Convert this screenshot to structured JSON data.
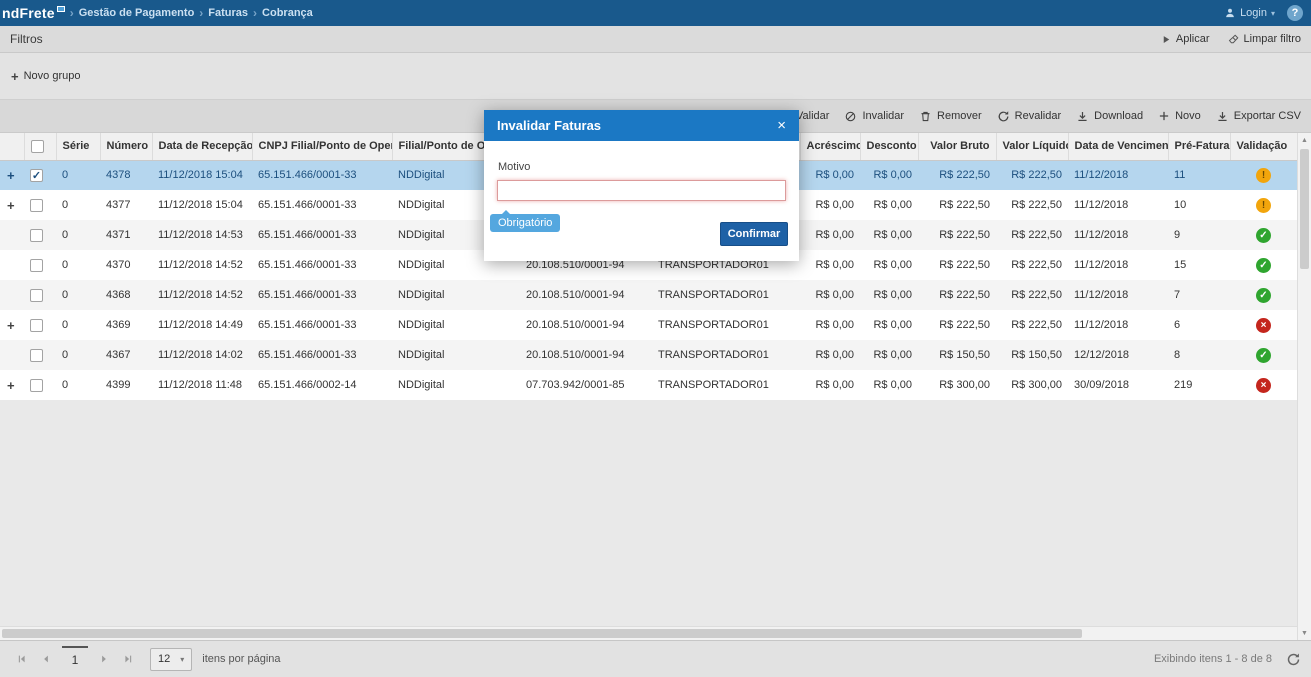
{
  "colors": {
    "topbar_bg": "#19598C",
    "modal_header_bg": "#1B78C4",
    "confirm_button_bg": "#1E61A6",
    "selected_row_bg": "#B5D6EE",
    "status_warning": "#F2A50C",
    "status_valid": "#2FA52F",
    "status_invalid": "#C4261D",
    "required_badge_bg": "#54A7DF"
  },
  "icons": {
    "plus": "+",
    "check": "✓",
    "cross": "×",
    "warning": "!",
    "sort_desc": "↓",
    "caret_down": "▾",
    "breadcrumb_sep": "›",
    "arrow_up": "▲",
    "arrow_down": "▼"
  },
  "topbar": {
    "logo": "ndFrete",
    "breadcrumbs": [
      "Gestão de Pagamento",
      "Faturas",
      "Cobrança"
    ],
    "login_label": "Login",
    "help_label": "?"
  },
  "filters": {
    "title": "Filtros",
    "apply_label": "Aplicar",
    "clear_label": "Limpar filtro"
  },
  "groups": {
    "new_group_label": "Novo grupo"
  },
  "toolbar": {
    "validate": "Validar",
    "invalidate": "Invalidar",
    "remove": "Remover",
    "revalidate": "Revalidar",
    "download": "Download",
    "new": "Novo",
    "export_csv": "Exportar CSV"
  },
  "table": {
    "headers": [
      "",
      "",
      "Série",
      "Número",
      "Data de Recepção",
      "CNPJ Filial/Ponto de Operação",
      "Filial/Ponto de Operação",
      "",
      "",
      "Acréscimo",
      "Desconto",
      "Valor Bruto",
      "Valor Líquido",
      "Data de Vencimento",
      "Pré-Fatura",
      "Validação"
    ],
    "rows": [
      {
        "expand": true,
        "checked": true,
        "selected": true,
        "serie": "0",
        "numero": "4378",
        "recepcao": "11/12/2018 15:04",
        "cnpj_filial": "65.151.466/0001-33",
        "filial": "NDDigital",
        "cnpj_transportador": "",
        "transportador": "",
        "acrescimo": "R$ 0,00",
        "desconto": "R$ 0,00",
        "valor_bruto": "R$ 222,50",
        "valor_liquido": "R$ 222,50",
        "vencimento": "11/12/2018",
        "pre_fatura": "11",
        "validacao": "warning"
      },
      {
        "expand": true,
        "checked": false,
        "selected": false,
        "serie": "0",
        "numero": "4377",
        "recepcao": "11/12/2018 15:04",
        "cnpj_filial": "65.151.466/0001-33",
        "filial": "NDDigital",
        "cnpj_transportador": "",
        "transportador": "",
        "acrescimo": "R$ 0,00",
        "desconto": "R$ 0,00",
        "valor_bruto": "R$ 222,50",
        "valor_liquido": "R$ 222,50",
        "vencimento": "11/12/2018",
        "pre_fatura": "10",
        "validacao": "warning"
      },
      {
        "expand": false,
        "checked": false,
        "selected": false,
        "serie": "0",
        "numero": "4371",
        "recepcao": "11/12/2018 14:53",
        "cnpj_filial": "65.151.466/0001-33",
        "filial": "NDDigital",
        "cnpj_transportador": "",
        "transportador": "",
        "acrescimo": "R$ 0,00",
        "desconto": "R$ 0,00",
        "valor_bruto": "R$ 222,50",
        "valor_liquido": "R$ 222,50",
        "vencimento": "11/12/2018",
        "pre_fatura": "9",
        "validacao": "valid"
      },
      {
        "expand": false,
        "checked": false,
        "selected": false,
        "serie": "0",
        "numero": "4370",
        "recepcao": "11/12/2018 14:52",
        "cnpj_filial": "65.151.466/0001-33",
        "filial": "NDDigital",
        "cnpj_transportador": "20.108.510/0001-94",
        "transportador": "TRANSPORTADOR01",
        "acrescimo": "R$ 0,00",
        "desconto": "R$ 0,00",
        "valor_bruto": "R$ 222,50",
        "valor_liquido": "R$ 222,50",
        "vencimento": "11/12/2018",
        "pre_fatura": "15",
        "validacao": "valid"
      },
      {
        "expand": false,
        "checked": false,
        "selected": false,
        "serie": "0",
        "numero": "4368",
        "recepcao": "11/12/2018 14:52",
        "cnpj_filial": "65.151.466/0001-33",
        "filial": "NDDigital",
        "cnpj_transportador": "20.108.510/0001-94",
        "transportador": "TRANSPORTADOR01",
        "acrescimo": "R$ 0,00",
        "desconto": "R$ 0,00",
        "valor_bruto": "R$ 222,50",
        "valor_liquido": "R$ 222,50",
        "vencimento": "11/12/2018",
        "pre_fatura": "7",
        "validacao": "valid"
      },
      {
        "expand": true,
        "checked": false,
        "selected": false,
        "serie": "0",
        "numero": "4369",
        "recepcao": "11/12/2018 14:49",
        "cnpj_filial": "65.151.466/0001-33",
        "filial": "NDDigital",
        "cnpj_transportador": "20.108.510/0001-94",
        "transportador": "TRANSPORTADOR01",
        "acrescimo": "R$ 0,00",
        "desconto": "R$ 0,00",
        "valor_bruto": "R$ 222,50",
        "valor_liquido": "R$ 222,50",
        "vencimento": "11/12/2018",
        "pre_fatura": "6",
        "validacao": "invalid"
      },
      {
        "expand": false,
        "checked": false,
        "selected": false,
        "serie": "0",
        "numero": "4367",
        "recepcao": "11/12/2018 14:02",
        "cnpj_filial": "65.151.466/0001-33",
        "filial": "NDDigital",
        "cnpj_transportador": "20.108.510/0001-94",
        "transportador": "TRANSPORTADOR01",
        "acrescimo": "R$ 0,00",
        "desconto": "R$ 0,00",
        "valor_bruto": "R$ 150,50",
        "valor_liquido": "R$ 150,50",
        "vencimento": "12/12/2018",
        "pre_fatura": "8",
        "validacao": "valid"
      },
      {
        "expand": true,
        "checked": false,
        "selected": false,
        "serie": "0",
        "numero": "4399",
        "recepcao": "11/12/2018 11:48",
        "cnpj_filial": "65.151.466/0002-14",
        "filial": "NDDigital",
        "cnpj_transportador": "07.703.942/0001-85",
        "transportador": "TRANSPORTADOR01",
        "acrescimo": "R$ 0,00",
        "desconto": "R$ 0,00",
        "valor_bruto": "R$ 300,00",
        "valor_liquido": "R$ 300,00",
        "vencimento": "30/09/2018",
        "pre_fatura": "219",
        "validacao": "invalid"
      }
    ]
  },
  "modal": {
    "title": "Invalidar Faturas",
    "close_label": "×",
    "motivo_label": "Motivo",
    "input_value": "",
    "required_badge": "Obrigatório",
    "confirm_label": "Confirmar"
  },
  "pagination": {
    "page": "1",
    "per_page": "12",
    "items_label": "itens por página",
    "status": "Exibindo itens 1 - 8 de 8"
  }
}
